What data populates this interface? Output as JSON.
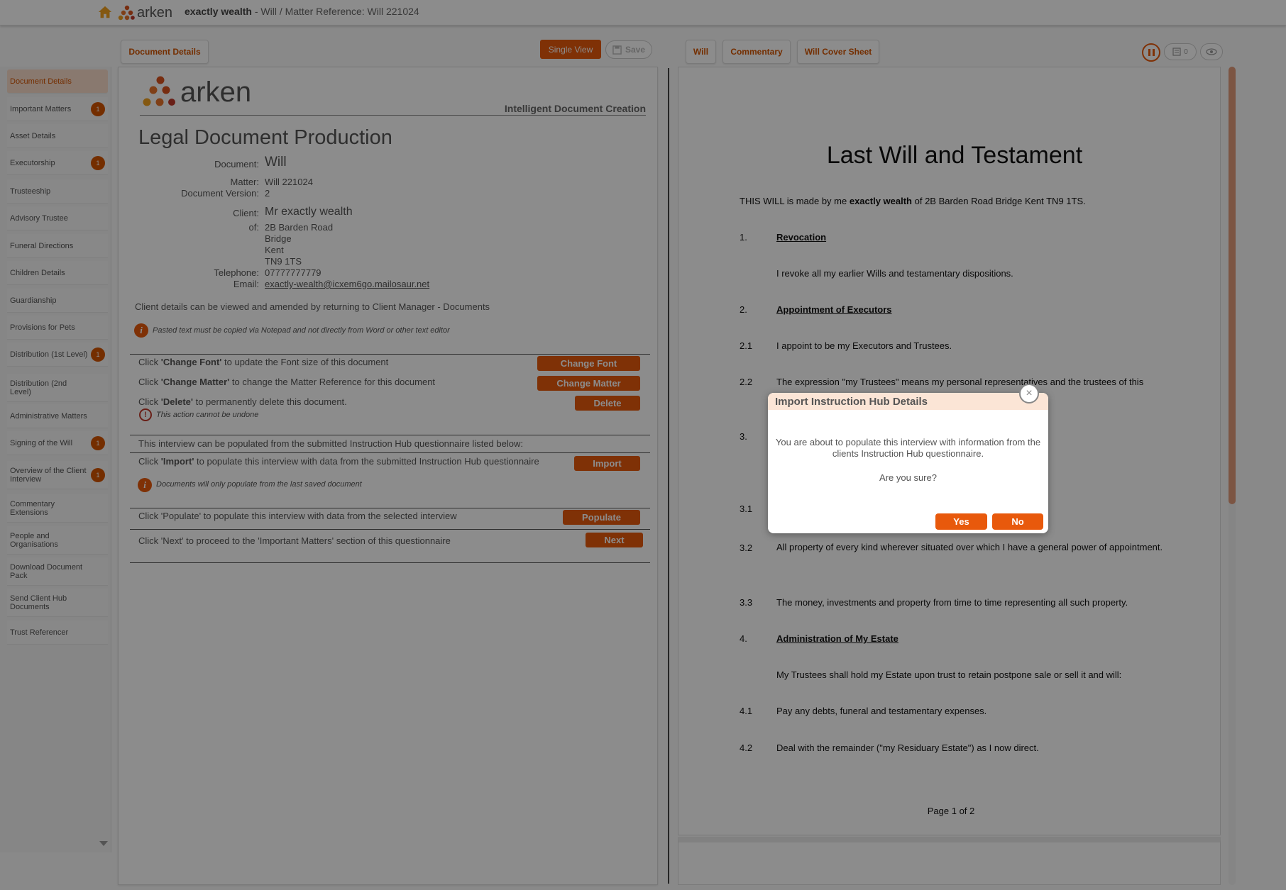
{
  "topbar": {
    "logo_text": "arken",
    "title_bold": "exactly wealth",
    "title_rest": " - Will / Matter Reference: Will 221024"
  },
  "left_toolbar": {
    "document_details_tab": "Document Details",
    "single_view_button": "Single View",
    "save_button": "Save"
  },
  "sidebar": {
    "items": [
      {
        "label": "Document Details",
        "badge": ""
      },
      {
        "label": "Important Matters",
        "badge": "1"
      },
      {
        "label": "Asset Details",
        "badge": ""
      },
      {
        "label": "Executorship",
        "badge": "1"
      },
      {
        "label": "Trusteeship",
        "badge": ""
      },
      {
        "label": "Advisory Trustee",
        "badge": ""
      },
      {
        "label": "Funeral Directions",
        "badge": ""
      },
      {
        "label": "Children Details",
        "badge": ""
      },
      {
        "label": "Guardianship",
        "badge": ""
      },
      {
        "label": "Provisions for Pets",
        "badge": ""
      },
      {
        "label": "Distribution (1st Level)",
        "badge": "1"
      },
      {
        "label": "Distribution (2nd Level)",
        "badge": ""
      },
      {
        "label": "Administrative Matters",
        "badge": ""
      },
      {
        "label": "Signing of the Will",
        "badge": "1"
      },
      {
        "label": "Overview of the Client Interview",
        "badge": "1"
      },
      {
        "label": "Commentary Extensions",
        "badge": ""
      },
      {
        "label": "People and Organisations",
        "badge": ""
      },
      {
        "label": "Download Document Pack",
        "badge": ""
      },
      {
        "label": "Send Client Hub Documents",
        "badge": ""
      },
      {
        "label": "Trust Referencer",
        "badge": ""
      }
    ]
  },
  "doc": {
    "logo_text": "arken",
    "tagline": "Intelligent Document Creation",
    "heading": "Legal Document Production",
    "document_label": "Document:",
    "document_value": "Will",
    "matter_label": "Matter:",
    "matter_value": "Will 221024",
    "version_label": "Document Version:",
    "version_value": "2",
    "client_label": "Client:",
    "client_value": "Mr exactly wealth",
    "of_label": "of:",
    "address": [
      "2B Barden Road",
      "Bridge",
      "Kent",
      "TN9 1TS"
    ],
    "telephone_label": "Telephone:",
    "telephone_value": "07777777779",
    "email_label": "Email:",
    "email_value": "exactly-wealth@icxem6go.mailosaur.net",
    "client_note": "Client details can be viewed and amended by returning to Client Manager - Documents",
    "paste_note": "Pasted text must be copied via Notepad and not directly from Word or other text editor",
    "change_font": {
      "pre": "Click ",
      "bold": "'Change Font'",
      "post": " to update the Font size of this document",
      "button": "Change Font"
    },
    "change_matter": {
      "pre": "Click ",
      "bold": "'Change Matter'",
      "post": " to change the Matter Reference for this document",
      "button": "Change Matter"
    },
    "delete": {
      "pre": "Click ",
      "bold": "'Delete'",
      "post": " to permanently delete this document.",
      "button": "Delete",
      "warning": "This action cannot be undone"
    },
    "hub_note": "This interview can be populated from the submitted Instruction Hub questionnaire listed below:",
    "import": {
      "pre": "Click ",
      "bold": "'Import'",
      "post": " to populate this interview with data from the submitted Instruction Hub questionnaire",
      "button": "Import",
      "note": "Documents will only populate from the last saved document"
    },
    "populate": {
      "text": "Click 'Populate' to populate this interview with data from the selected interview",
      "button": "Populate"
    },
    "next": {
      "text": "Click 'Next' to proceed to the 'Important Matters' section of this questionnaire",
      "button": "Next"
    }
  },
  "right_toolbar": {
    "tabs": [
      "Will",
      "Commentary",
      "Will Cover Sheet"
    ],
    "count_pill": "0"
  },
  "will": {
    "title": "Last Will and Testament",
    "intro_pre": "THIS WILL is made by me ",
    "intro_bold": "exactly wealth",
    "intro_post": " of 2B Barden Road Bridge Kent TN9 1TS.",
    "s1_num": "1.",
    "s1_head": "Revocation",
    "s1_text": "I revoke all my earlier Wills and testamentary dispositions.",
    "s2_num": "2.",
    "s2_head": "Appointment of Executors",
    "s21_num": "2.1",
    "s21_text": "I appoint to be my Executors and Trustees.",
    "s22_num": "2.2",
    "s22_text": "The expression \"my Trustees\" means my personal representatives and the trustees of this",
    "s3_num": "3.",
    "s31_num": "3.1",
    "s32_num": "3.2",
    "s32_text": "All property of every kind wherever situated over which I have a general power of appointment.",
    "s33_num": "3.3",
    "s33_text": "The money, investments and property from time to time representing all such property.",
    "s4_num": "4.",
    "s4_head": "Administration of My Estate",
    "s4_text": "My Trustees shall hold my Estate upon trust to retain postpone sale or sell it and will:",
    "s41_num": "4.1",
    "s41_text": "Pay any debts, funeral and testamentary expenses.",
    "s42_num": "4.2",
    "s42_text": "Deal with the remainder (\"my Residuary Estate\") as I now direct.",
    "page": "Page 1 of 2"
  },
  "modal": {
    "title": "Import Instruction Hub Details",
    "body_line1": "You are about to populate this interview with information from the",
    "body_line2": "clients Instruction Hub questionnaire.",
    "question": "Are you sure?",
    "yes": "Yes",
    "no": "No",
    "close": "×"
  },
  "colors": {
    "accent": "#e8590c",
    "accent_light": "#fbe5d6"
  }
}
